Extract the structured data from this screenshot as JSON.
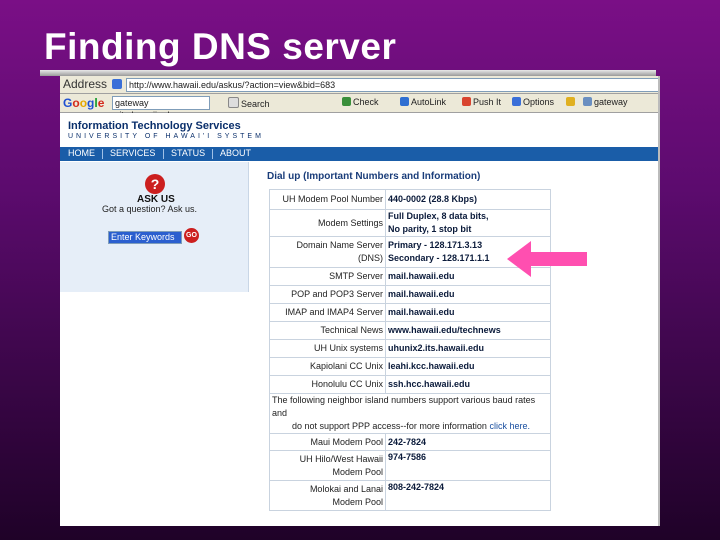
{
  "slide": {
    "title": "Finding DNS server"
  },
  "browser": {
    "address_label": "Address",
    "url": "http://www.hawaii.edu/askus/?action=view&bid=683",
    "toolbar": {
      "search_value": "gateway site:hawaii.edu",
      "search_btn": "Search",
      "check": "Check",
      "autolink": "AutoLink",
      "autofill": "",
      "pushit": "Push It",
      "options": "Options",
      "gateway": "gateway"
    }
  },
  "site": {
    "title": "Information Technology Services",
    "subtitle": "UNIVERSITY OF HAWAI'I SYSTEM",
    "nav": [
      "HOME",
      "SERVICES",
      "STATUS",
      "ABOUT"
    ]
  },
  "sidebar": {
    "ask_label": "ASK US",
    "question": "Got a question? Ask us.",
    "keywords_value": "Enter Keywords",
    "go_label": "GO"
  },
  "content": {
    "heading": "Dial up (Important Numbers and Information)",
    "rows": [
      {
        "label": "UH Modem Pool Number",
        "value": "440-0002 (28.8 Kbps)"
      },
      {
        "label": "Modem Settings",
        "value": "Full Duplex, 8 data bits,",
        "value2": "No parity, 1 stop bit"
      },
      {
        "label": "Domain Name Server",
        "label2": "(DNS)",
        "value": "Primary - 128.171.3.13",
        "value2": "Secondary - 128.171.1.1"
      },
      {
        "label": "SMTP Server",
        "value": "mail.hawaii.edu"
      },
      {
        "label": "POP and POP3 Server",
        "value": "mail.hawaii.edu"
      },
      {
        "label": "IMAP and IMAP4 Server",
        "value": "mail.hawaii.edu"
      },
      {
        "label": "Technical News",
        "value": "www.hawaii.edu/technews"
      },
      {
        "label": "UH Unix systems",
        "value": "uhunix2.its.hawaii.edu"
      },
      {
        "label": "Kapiolani CC Unix",
        "value": "leahi.kcc.hawaii.edu"
      },
      {
        "label": "Honolulu CC Unix",
        "value": "ssh.hcc.hawaii.edu"
      }
    ],
    "note": "The following neighbor island numbers support various baud rates and",
    "note2": "do not support PPP access--for more information",
    "note_link": "click here.",
    "rows2": [
      {
        "label": "Maui Modem Pool",
        "value": "242-7824"
      },
      {
        "label": "UH Hilo/West Hawaii",
        "label2": "Modem Pool",
        "value": "974-7586"
      },
      {
        "label": "Molokai and Lanai",
        "label2": "Modem Pool",
        "value": "808-242-7824"
      }
    ]
  },
  "colors": {
    "accent_arrow": "#ff4fb0",
    "nav_bar": "#1a5da8"
  }
}
